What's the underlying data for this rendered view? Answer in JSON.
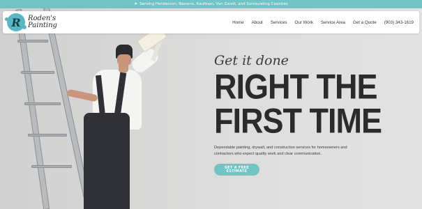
{
  "topbar": {
    "pin_icon": "location-arrow-icon",
    "text": "Serving Henderson, Navarro, Kaufman, Van Zandt, and Surrounding Counties"
  },
  "header": {
    "logo": {
      "letter": "R",
      "line1": "Roden's",
      "line2": "Painting"
    },
    "nav": [
      {
        "label": "Home"
      },
      {
        "label": "About"
      },
      {
        "label": "Services"
      },
      {
        "label": "Our Work"
      },
      {
        "label": "Service Area"
      },
      {
        "label": "Get a Quote"
      },
      {
        "label": "(903) 343-1619"
      }
    ]
  },
  "hero": {
    "tagline": "Get it done",
    "headline_line1": "RIGHT THE",
    "headline_line2": "FIRST TIME",
    "description": "Dependable painting, drywall, and construction services for homeowners and contractors who expect quality work and clear communication.",
    "cta_label": "GET A FREE ESTIMATE"
  },
  "colors": {
    "accent": "#6fc4c5",
    "text_dark": "#2b2b2b"
  }
}
